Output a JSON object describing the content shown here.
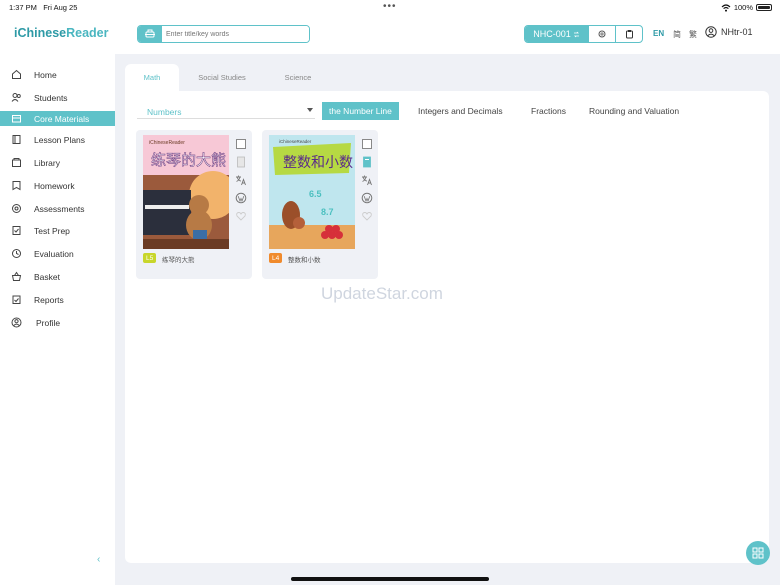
{
  "status_bar": {
    "time": "1:37 PM",
    "date": "Fri Aug 25",
    "battery": "100%"
  },
  "header": {
    "logo_part1": "iChinese",
    "logo_part2": "Reader",
    "search_placeholder": "Enter title/key words",
    "class_code": "NHC-001",
    "languages": [
      "EN",
      "简",
      "繁"
    ],
    "user_name": "NHtr-01"
  },
  "sidebar": {
    "items": [
      {
        "label": "Home",
        "icon": "home-icon"
      },
      {
        "label": "Students",
        "icon": "students-icon"
      },
      {
        "label": "Core Materials",
        "icon": "core-materials-icon"
      },
      {
        "label": "Lesson Plans",
        "icon": "lesson-plans-icon"
      },
      {
        "label": "Library",
        "icon": "library-icon"
      },
      {
        "label": "Homework",
        "icon": "homework-icon"
      },
      {
        "label": "Assessments",
        "icon": "assessments-icon"
      },
      {
        "label": "Test Prep",
        "icon": "test-prep-icon"
      },
      {
        "label": "Evaluation",
        "icon": "evaluation-icon"
      },
      {
        "label": "Basket",
        "icon": "basket-icon"
      },
      {
        "label": "Reports",
        "icon": "reports-icon"
      },
      {
        "label": "Profile",
        "icon": "profile-icon"
      }
    ],
    "collapse_glyph": "‹"
  },
  "tabs": [
    "Math",
    "Social Studies",
    "Science"
  ],
  "filter": {
    "dropdown_value": "Numbers",
    "topics": [
      "the Number Line",
      "Integers and Decimals",
      "Fractions",
      "Rounding and Valuation"
    ]
  },
  "books": [
    {
      "level": "L5",
      "title": "练琴的大熊",
      "level_color": "#c8d62b",
      "cover_title": "练琴的大熊",
      "cover_brand": "iChineseReader"
    },
    {
      "level": "L4",
      "title": "整数和小数",
      "level_color": "#f08a2c",
      "cover_title": "整数和小数",
      "cover_brand": "iChineseReader",
      "cover_numbers": [
        "6.5",
        "8.7"
      ]
    }
  ],
  "watermark": "UpdateStar.com",
  "colors": {
    "accent": "#5fc2c9",
    "brand": "#2e9aa6",
    "background": "#eff1f6"
  }
}
